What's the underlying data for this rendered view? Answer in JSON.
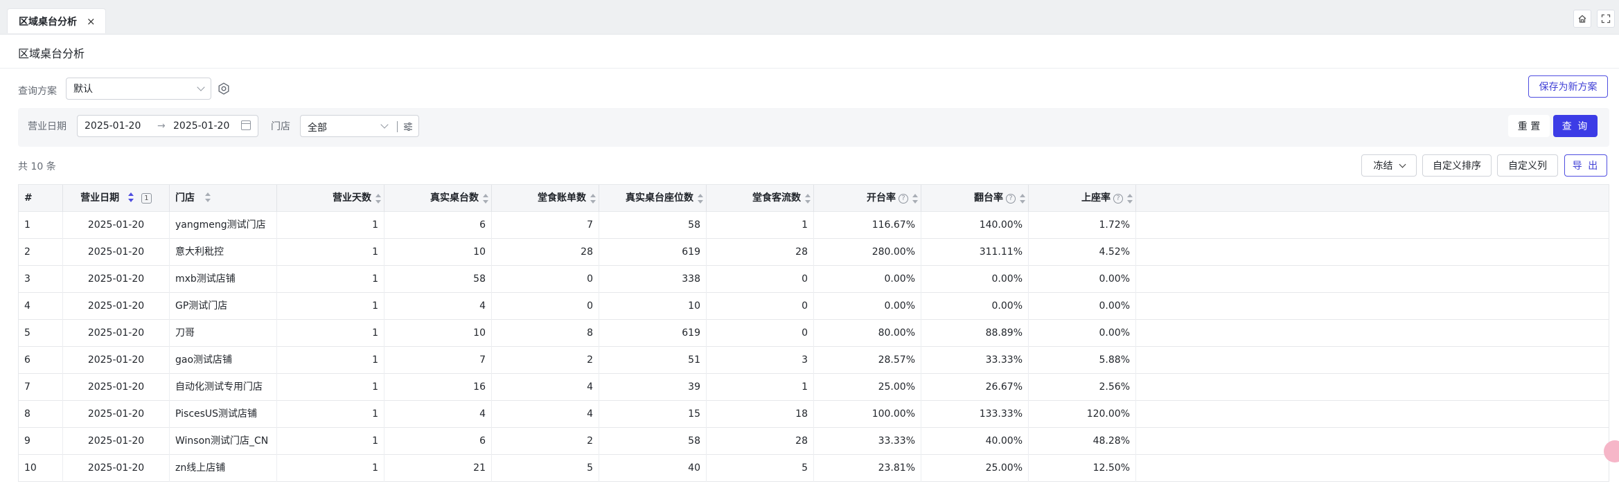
{
  "tabbar": {
    "active_tab": "区域桌台分析",
    "close_glyph": "×"
  },
  "page": {
    "title": "区域桌台分析"
  },
  "scheme": {
    "label": "查询方案",
    "value": "默认",
    "save_new": "保存为新方案"
  },
  "filters": {
    "date_label": "营业日期",
    "date_start": "2025-01-20",
    "date_separator": "→",
    "date_end": "2025-01-20",
    "store_label": "门店",
    "store_value": "全部",
    "reset": "重 置",
    "query": "查 询"
  },
  "toolbar": {
    "count": "共 10 条",
    "freeze": "冻结",
    "custom_sort": "自定义排序",
    "custom_columns": "自定义列",
    "export": "导 出"
  },
  "table": {
    "headers": {
      "index": "#",
      "date": "营业日期",
      "date_sort_order": "1",
      "store": "门店",
      "days": "营业天数",
      "tables": "真实桌台数",
      "bills": "堂食账单数",
      "seats": "真实桌台座位数",
      "guests": "堂食客流数",
      "open_rate": "开台率",
      "turn_rate": "翻台率",
      "seat_rate": "上座率"
    },
    "help_glyph": "?",
    "rows": [
      {
        "idx": "1",
        "date": "2025-01-20",
        "store": "yangmeng测试门店",
        "days": "1",
        "tables": "6",
        "bills": "7",
        "seats": "58",
        "guests": "1",
        "open": "116.67%",
        "turn": "140.00%",
        "seat": "1.72%"
      },
      {
        "idx": "2",
        "date": "2025-01-20",
        "store": "意大利秕控",
        "days": "1",
        "tables": "10",
        "bills": "28",
        "seats": "619",
        "guests": "28",
        "open": "280.00%",
        "turn": "311.11%",
        "seat": "4.52%"
      },
      {
        "idx": "3",
        "date": "2025-01-20",
        "store": "mxb测试店铺",
        "days": "1",
        "tables": "58",
        "bills": "0",
        "seats": "338",
        "guests": "0",
        "open": "0.00%",
        "turn": "0.00%",
        "seat": "0.00%"
      },
      {
        "idx": "4",
        "date": "2025-01-20",
        "store": "GP测试门店",
        "days": "1",
        "tables": "4",
        "bills": "0",
        "seats": "10",
        "guests": "0",
        "open": "0.00%",
        "turn": "0.00%",
        "seat": "0.00%"
      },
      {
        "idx": "5",
        "date": "2025-01-20",
        "store": "刀哥",
        "days": "1",
        "tables": "10",
        "bills": "8",
        "seats": "619",
        "guests": "0",
        "open": "80.00%",
        "turn": "88.89%",
        "seat": "0.00%"
      },
      {
        "idx": "6",
        "date": "2025-01-20",
        "store": "gao测试店铺",
        "days": "1",
        "tables": "7",
        "bills": "2",
        "seats": "51",
        "guests": "3",
        "open": "28.57%",
        "turn": "33.33%",
        "seat": "5.88%"
      },
      {
        "idx": "7",
        "date": "2025-01-20",
        "store": "自动化测试专用门店",
        "days": "1",
        "tables": "16",
        "bills": "4",
        "seats": "39",
        "guests": "1",
        "open": "25.00%",
        "turn": "26.67%",
        "seat": "2.56%"
      },
      {
        "idx": "8",
        "date": "2025-01-20",
        "store": "PiscesUS测试店铺",
        "days": "1",
        "tables": "4",
        "bills": "4",
        "seats": "15",
        "guests": "18",
        "open": "100.00%",
        "turn": "133.33%",
        "seat": "120.00%"
      },
      {
        "idx": "9",
        "date": "2025-01-20",
        "store": "Winson测试门店_CN",
        "days": "1",
        "tables": "6",
        "bills": "2",
        "seats": "58",
        "guests": "28",
        "open": "33.33%",
        "turn": "40.00%",
        "seat": "48.28%"
      },
      {
        "idx": "10",
        "date": "2025-01-20",
        "store": "zn线上店铺",
        "days": "1",
        "tables": "21",
        "bills": "5",
        "seats": "40",
        "guests": "5",
        "open": "23.81%",
        "turn": "25.00%",
        "seat": "12.50%"
      }
    ]
  },
  "icons": {
    "tab_close": "close-icon",
    "home": "home-icon",
    "fullscreen": "fullscreen-icon",
    "scheme_settings": "gear-icon",
    "calendar": "calendar-icon",
    "store_filter": "sliders-icon"
  },
  "colors": {
    "primary": "#3c3ce6",
    "accent_float": "#f6b6c8"
  }
}
